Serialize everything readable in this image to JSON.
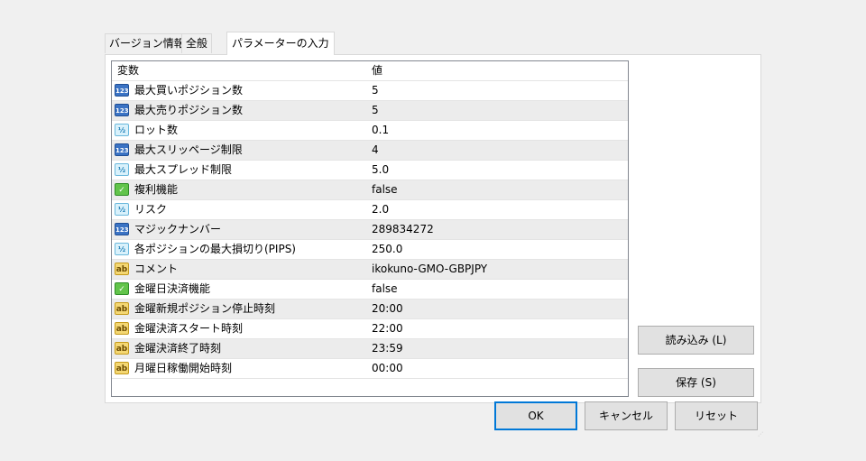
{
  "tabs": [
    {
      "label": "バージョン情報"
    },
    {
      "label": "全般"
    },
    {
      "label": "パラメーターの入力"
    }
  ],
  "table": {
    "headers": {
      "name": "変数",
      "value": "値"
    },
    "rows": [
      {
        "type_icon": "int-icon",
        "name": "最大買いポジション数",
        "value": "5"
      },
      {
        "type_icon": "int-icon",
        "name": "最大売りポジション数",
        "value": "5"
      },
      {
        "type_icon": "double-icon",
        "name": "ロット数",
        "value": "0.1"
      },
      {
        "type_icon": "int-icon",
        "name": "最大スリッページ制限",
        "value": "4"
      },
      {
        "type_icon": "double-icon",
        "name": "最大スプレッド制限",
        "value": "5.0"
      },
      {
        "type_icon": "bool-icon",
        "name": "複利機能",
        "value": "false"
      },
      {
        "type_icon": "double-icon",
        "name": "リスク",
        "value": "2.0"
      },
      {
        "type_icon": "int-icon",
        "name": "マジックナンバー",
        "value": "289834272"
      },
      {
        "type_icon": "double-icon",
        "name": "各ポジションの最大損切り(PIPS)",
        "value": "250.0"
      },
      {
        "type_icon": "string-icon",
        "name": "コメント",
        "value": "ikokuno-GMO-GBPJPY"
      },
      {
        "type_icon": "bool-icon",
        "name": "金曜日決済機能",
        "value": "false"
      },
      {
        "type_icon": "string-icon",
        "name": "金曜新規ポジション停止時刻",
        "value": "20:00"
      },
      {
        "type_icon": "string-icon",
        "name": "金曜決済スタート時刻",
        "value": "22:00"
      },
      {
        "type_icon": "string-icon",
        "name": "金曜決済終了時刻",
        "value": "23:59"
      },
      {
        "type_icon": "string-icon",
        "name": "月曜日稼働開始時刻",
        "value": "00:00"
      }
    ]
  },
  "icon_glyphs": {
    "int": "123",
    "double": "½",
    "bool": "✓",
    "string": "ab"
  },
  "buttons": {
    "load": "読み込み (L)",
    "save": "保存 (S)",
    "ok": "OK",
    "cancel": "キャンセル",
    "reset": "リセット"
  },
  "colors": {
    "accent": "#0078d7",
    "row_alt": "#ececec"
  }
}
